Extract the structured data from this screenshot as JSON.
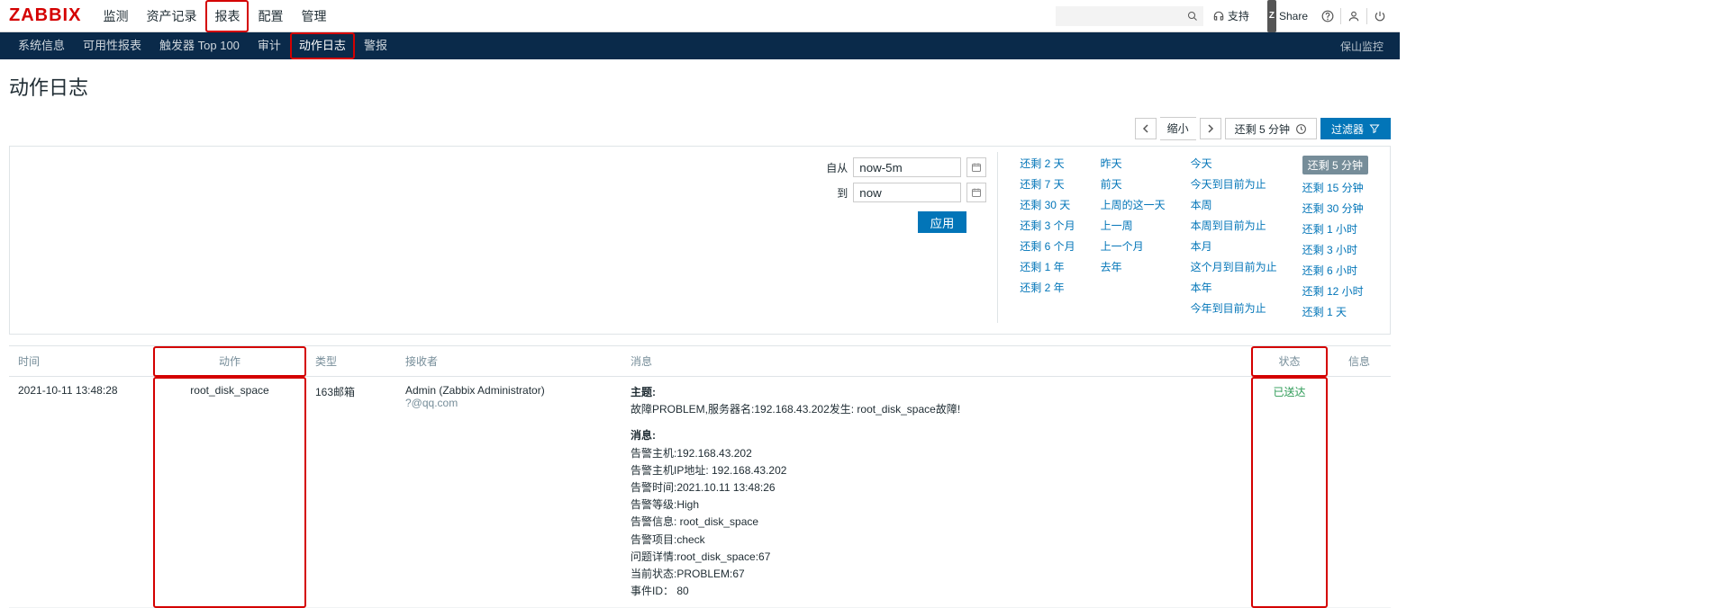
{
  "logo": "ZABBIX",
  "mainnav": [
    "监测",
    "资产记录",
    "报表",
    "配置",
    "管理"
  ],
  "mainnav_active_index": 2,
  "subnav": [
    "系统信息",
    "可用性报表",
    "触发器 Top 100",
    "审计",
    "动作日志",
    "警报"
  ],
  "subnav_active_index": 4,
  "tenant": "保山监控",
  "support": "支持",
  "share": "Share",
  "page_title": "动作日志",
  "zoom_out": "缩小",
  "range_label": "还剩 5 分钟",
  "filter_button": "过滤器",
  "filter_form": {
    "from_label": "自从",
    "from_value": "now-5m",
    "to_label": "到",
    "to_value": "now",
    "apply": "应用"
  },
  "presets": {
    "col1": [
      "还剩 2 天",
      "还剩 7 天",
      "还剩 30 天",
      "还剩 3 个月",
      "还剩 6 个月",
      "还剩 1 年",
      "还剩 2 年"
    ],
    "col2": [
      "昨天",
      "前天",
      "上周的这一天",
      "上一周",
      "上一个月",
      "去年"
    ],
    "col3": [
      "今天",
      "今天到目前为止",
      "本周",
      "本周到目前为止",
      "本月",
      "这个月到目前为止",
      "本年",
      "今年到目前为止"
    ],
    "col4": [
      "还剩 5 分钟",
      "还剩 15 分钟",
      "还剩 30 分钟",
      "还剩 1 小时",
      "还剩 3 小时",
      "还剩 6 小时",
      "还剩 12 小时",
      "还剩 1 天"
    ],
    "col4_active_index": 0
  },
  "columns": {
    "time": "时间",
    "action": "动作",
    "type": "类型",
    "recipient": "接收者",
    "message": "消息",
    "status": "状态",
    "info": "信息"
  },
  "row": {
    "time": "2021-10-11 13:48:28",
    "action": "root_disk_space",
    "type": "163邮箱",
    "recipient_1": "Admin (Zabbix Administrator)",
    "recipient_2": "?@qq.com",
    "msg_subject_label": "主题:",
    "msg_subject": "故障PROBLEM,服务器名:192.168.43.202发生: root_disk_space故障!",
    "msg_body_label": "消息:",
    "msg_lines": [
      "告警主机:192.168.43.202",
      "告警主机IP地址: 192.168.43.202",
      "告警时间:2021.10.11 13:48:26",
      "告警等级:High",
      "告警信息: root_disk_space",
      "告警项目:check",
      "问题详情:root_disk_space:67",
      "当前状态:PROBLEM:67",
      "事件ID： 80"
    ],
    "status": "已送达"
  }
}
